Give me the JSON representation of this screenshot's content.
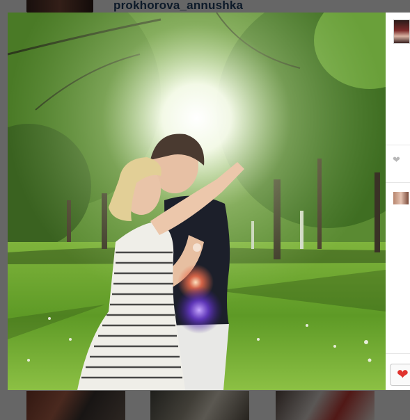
{
  "profile": {
    "username": "prokhorova_annushka"
  },
  "lightbox": {
    "photo_icon": "couple-kissing-in-park-photo",
    "sidebar": {
      "owner_avatar_icon": "user-avatar",
      "like_icon": "heart-outline-icon",
      "comment_avatar_icon": "commenter-avatar",
      "like_button_icon": "heart-filled-icon"
    }
  },
  "colors": {
    "username": "#1f3f63",
    "like_heart": "#e0332e",
    "overlay": "rgba(0,0,0,0.58)"
  }
}
